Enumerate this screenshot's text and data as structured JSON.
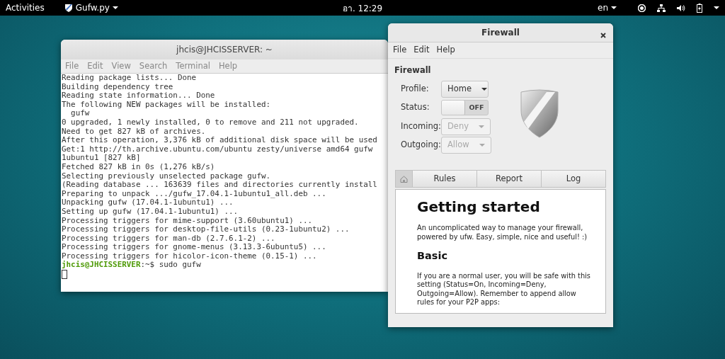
{
  "top_bar": {
    "activities": "Activities",
    "app_menu": "Gufw.py",
    "clock": "อา. 12:29",
    "language": "en"
  },
  "terminal": {
    "title": "jhcis@JHCISSERVER: ~",
    "menu": [
      "File",
      "Edit",
      "View",
      "Search",
      "Terminal",
      "Help"
    ],
    "lines": [
      "Reading package lists... Done",
      "Building dependency tree",
      "Reading state information... Done",
      "The following NEW packages will be installed:",
      "  gufw",
      "0 upgraded, 1 newly installed, 0 to remove and 211 not upgraded.",
      "Need to get 827 kB of archives.",
      "After this operation, 3,376 kB of additional disk space will be used",
      "Get:1 http://th.archive.ubuntu.com/ubuntu zesty/universe amd64 gufw",
      "1ubuntu1 [827 kB]",
      "Fetched 827 kB in 0s (1,276 kB/s)",
      "Selecting previously unselected package gufw.",
      "(Reading database ... 163639 files and directories currently install",
      "Preparing to unpack .../gufw_17.04.1-1ubuntu1_all.deb ...",
      "Unpacking gufw (17.04.1-1ubuntu1) ...",
      "Setting up gufw (17.04.1-1ubuntu1) ...",
      "Processing triggers for mime-support (3.60ubuntu1) ...",
      "Processing triggers for desktop-file-utils (0.23-1ubuntu2) ...",
      "Processing triggers for man-db (2.7.6.1-2) ...",
      "Processing triggers for gnome-menus (3.13.3-6ubuntu5) ...",
      "Processing triggers for hicolor-icon-theme (0.15-1) ..."
    ],
    "prompt": {
      "user_host": "jhcis@JHCISSERVER",
      "rest": ":~$ sudo gufw"
    }
  },
  "firewall": {
    "title": "Firewall",
    "menu": [
      "File",
      "Edit",
      "Help"
    ],
    "section": "Firewall",
    "fields": [
      {
        "label": "Profile:",
        "kind": "dropdown",
        "value": "Home",
        "disabled": false
      },
      {
        "label": "Status:",
        "kind": "toggle",
        "value": "OFF",
        "on": false
      },
      {
        "label": "Incoming:",
        "kind": "dropdown",
        "value": "Deny",
        "disabled": true
      },
      {
        "label": "Outgoing:",
        "kind": "dropdown",
        "value": "Allow",
        "disabled": true
      }
    ],
    "tabs": [
      {
        "kind": "home",
        "selected": true
      },
      {
        "kind": "text",
        "label": "Rules",
        "selected": false
      },
      {
        "kind": "text",
        "label": "Report",
        "selected": false
      },
      {
        "kind": "text",
        "label": "Log",
        "selected": false
      }
    ],
    "content": [
      {
        "kind": "h1",
        "text": "Getting started"
      },
      {
        "kind": "p",
        "text": "An uncomplicated way to manage your firewall, powered by ufw. Easy, simple, nice and useful! :)"
      },
      {
        "kind": "h2",
        "text": "Basic"
      },
      {
        "kind": "p",
        "text": "If you are a normal user, you will be safe with this setting (Status=On, Incoming=Deny, Outgoing=Allow). Remember to append allow rules for your P2P apps:"
      }
    ]
  }
}
